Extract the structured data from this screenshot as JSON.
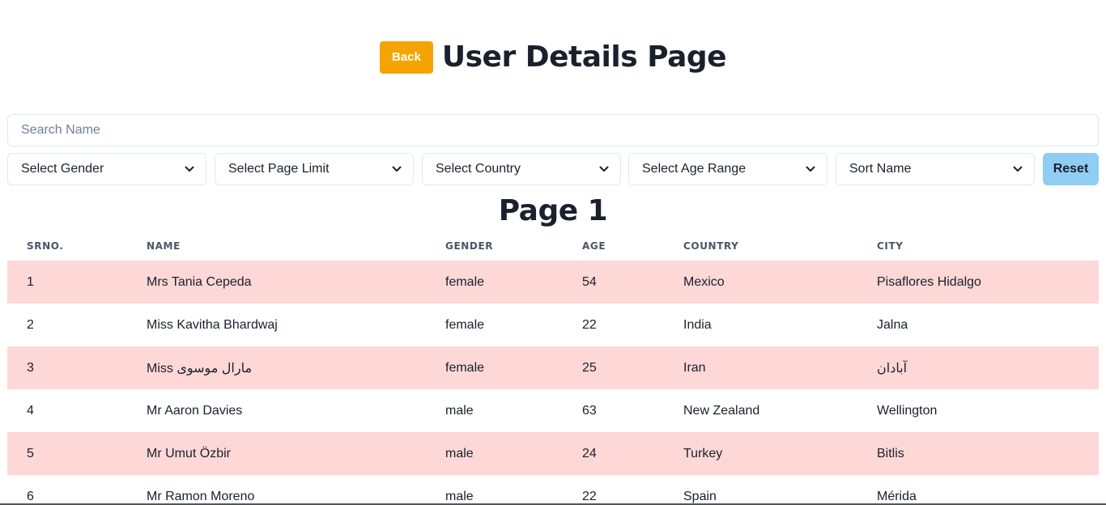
{
  "header": {
    "back_label": "Back",
    "title": "User Details Page"
  },
  "search": {
    "placeholder": "Search Name",
    "value": ""
  },
  "filters": {
    "gender": "Select Gender",
    "page_limit": "Select Page Limit",
    "country": "Select Country",
    "age_range": "Select Age Range",
    "sort": "Sort Name",
    "reset_label": "Reset"
  },
  "page_label": "Page 1",
  "table": {
    "columns": [
      "SRNO.",
      "NAME",
      "GENDER",
      "AGE",
      "COUNTRY",
      "CITY"
    ],
    "rows": [
      [
        "1",
        "Mrs Tania Cepeda",
        "female",
        "54",
        "Mexico",
        "Pisaflores Hidalgo"
      ],
      [
        "2",
        "Miss Kavitha Bhardwaj",
        "female",
        "22",
        "India",
        "Jalna"
      ],
      [
        "3",
        "Miss مارال موسوی",
        "female",
        "25",
        "Iran",
        "آبادان"
      ],
      [
        "4",
        "Mr Aaron Davies",
        "male",
        "63",
        "New Zealand",
        "Wellington"
      ],
      [
        "5",
        "Mr Umut Özbir",
        "male",
        "24",
        "Turkey",
        "Bitlis"
      ],
      [
        "6",
        "Mr Ramon Moreno",
        "male",
        "22",
        "Spain",
        "Mérida"
      ]
    ]
  },
  "colors": {
    "back_button": "#f6a404",
    "reset_button": "#90cdf4",
    "row_highlight": "#fed7d7"
  }
}
